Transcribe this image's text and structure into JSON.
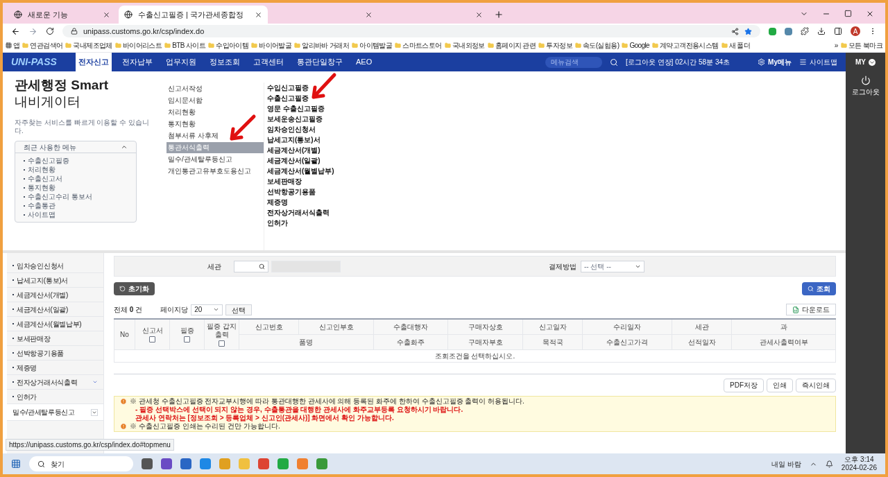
{
  "browser": {
    "tabs": [
      {
        "title": "새로운 기능",
        "selected": false
      },
      {
        "title": "수출신고필증 | 국가관세종합정",
        "selected": true
      },
      {
        "selected": false
      },
      {
        "selected": false
      }
    ],
    "address": "unipass.customs.go.kr/csp/index.do",
    "bookmarks": [
      "앱",
      "연관검색어",
      "국내제조업체",
      "바이어리스트",
      "BTB 사이트",
      "수입아이템",
      "바이어발굴",
      "알리바바 거래처",
      "아이템발굴",
      "스마트스토어",
      "국내외정보",
      "홈페이지 관련",
      "투자정보",
      "속도(실험용)",
      "Google",
      "계약고객전용시스템",
      "새 폴더"
    ],
    "bookmarks_more": "»",
    "all_bookmarks": "모든 북마크",
    "profile": "A"
  },
  "nav": {
    "logo": "UNI-PASS",
    "items": [
      {
        "label": "전자신고",
        "selected": true
      },
      {
        "label": "전자납부",
        "selected": false
      },
      {
        "label": "업무지원",
        "selected": false
      },
      {
        "label": "정보조회",
        "selected": false
      },
      {
        "label": "고객센터",
        "selected": false
      },
      {
        "label": "통관단일창구",
        "selected": false
      },
      {
        "label": "AEO",
        "selected": false
      }
    ],
    "search_placeholder": "메뉴검색",
    "session": "[로그아웃 연장] 02시간 58분 34초",
    "my_menu": "My메뉴",
    "sitemap": "사이트맵",
    "my": "MY",
    "logout": "로그아웃"
  },
  "navigator": {
    "title": "관세행정 Smart",
    "subtitle": "내비게이터",
    "description": "자주찾는 서비스를 빠르게 이용할 수 있습니다.",
    "recent": {
      "title": "최근 사용한 메뉴",
      "expanded": true,
      "items": [
        "수출신고필증",
        "처리현황",
        "수출신고서",
        "통지현황",
        "수출신고수리 통보서",
        "수출통관",
        "사이트맵"
      ]
    },
    "column_2": [
      {
        "label": "신고서작성",
        "selected": false
      },
      {
        "label": "임시문서함",
        "selected": false
      },
      {
        "label": "처리현황",
        "selected": false
      },
      {
        "label": "통지현황",
        "selected": false
      },
      {
        "label": "첨부서류 사후제",
        "selected": false
      },
      {
        "label": "통관서식출력",
        "selected": true
      },
      {
        "label": "밀수/관세탈루등신고",
        "selected": false
      },
      {
        "label": "개인통관고유부호도용신고",
        "selected": false
      }
    ],
    "column_3": [
      "수입신고필증",
      "수출신고필증",
      "영문 수출신고필증",
      "보세운송신고필증",
      "임차승인신청서",
      "납세고지(통보)서",
      "세금계산서(개별)",
      "세금계산서(일괄)",
      "세금계산서(월별납부)",
      "보세판매장",
      "선박항공기용품",
      "제증명",
      "전자상거래서식출력",
      "인허가"
    ]
  },
  "sidebar": [
    {
      "label": "임차승인신청서",
      "kind": "item"
    },
    {
      "label": "납세고지(통보)서",
      "kind": "item"
    },
    {
      "label": "세금계산서(개별)",
      "kind": "item"
    },
    {
      "label": "세금계산서(일괄)",
      "kind": "item"
    },
    {
      "label": "세금계산서(월별납부)",
      "kind": "item"
    },
    {
      "label": "보세판매장",
      "kind": "item"
    },
    {
      "label": "선박항공기용품",
      "kind": "item"
    },
    {
      "label": "제증명",
      "kind": "item"
    },
    {
      "label": "전자상거래서식출력",
      "kind": "submenu"
    },
    {
      "label": "인허가",
      "kind": "item"
    },
    {
      "label": "밀수/관세탈루등신고",
      "kind": "group"
    }
  ],
  "filter": {
    "customs_label": "세관",
    "payment_label": "결제방법",
    "payment_value": "-- 선택 --"
  },
  "reset_button": "초기화",
  "search_button": "조회",
  "total": {
    "prefix": "전체",
    "count": "0",
    "suffix": "건"
  },
  "per_page_label": "페이지당",
  "per_page": "20",
  "select_button": "선택",
  "download_button": "다운로드",
  "table": {
    "no": "No",
    "check_columns": [
      {
        "label": "신고서",
        "checked": false
      },
      {
        "label": "필증",
        "checked": false
      },
      {
        "label": "필증 갑지출력",
        "checked": false
      }
    ],
    "row_1": [
      "신고번호",
      "신고인부호",
      "수출대행자",
      "구매자상호",
      "신고일자",
      "수리일자",
      "세관",
      "과"
    ],
    "row_2": [
      "품명",
      "수출화주",
      "구매자부호",
      "목적국",
      "수출신고가격",
      "선적일자",
      "관세사출력여부"
    ],
    "empty": "조회조건을 선택하십시오."
  },
  "print_buttons": [
    "PDF저장",
    "인쇄",
    "즉시인쇄"
  ],
  "notices": [
    {
      "kind": "note",
      "text": "※ 관세청 수출신고필증 전자교부시행에 따라 통관대행한 관세사에 의해 등록된 화주에 한하여 수출신고필증 출력이 허용됩니다."
    },
    {
      "kind": "warning",
      "text": "- 필증 선택박스에 선택이 되지 않는 경우, 수출통관을 대행한 관세사에 화주교부등록 요청하시기 바랍니다."
    },
    {
      "kind": "warning",
      "text": "관세사 연락처는 [정보조회 > 등록업체 > 신고인(관세사)] 화면에서 확인 가능합니다."
    },
    {
      "kind": "note",
      "text": "※ 수출신고필증 인쇄는 수리된 건만 가능합니다."
    }
  ],
  "status_url": "https://unipass.customs.go.kr/csp/index.do#topmenu",
  "taskbar": {
    "search": "찾기",
    "weather": "내일 바람",
    "time": "오후 3:14",
    "date": "2024-02-26"
  }
}
